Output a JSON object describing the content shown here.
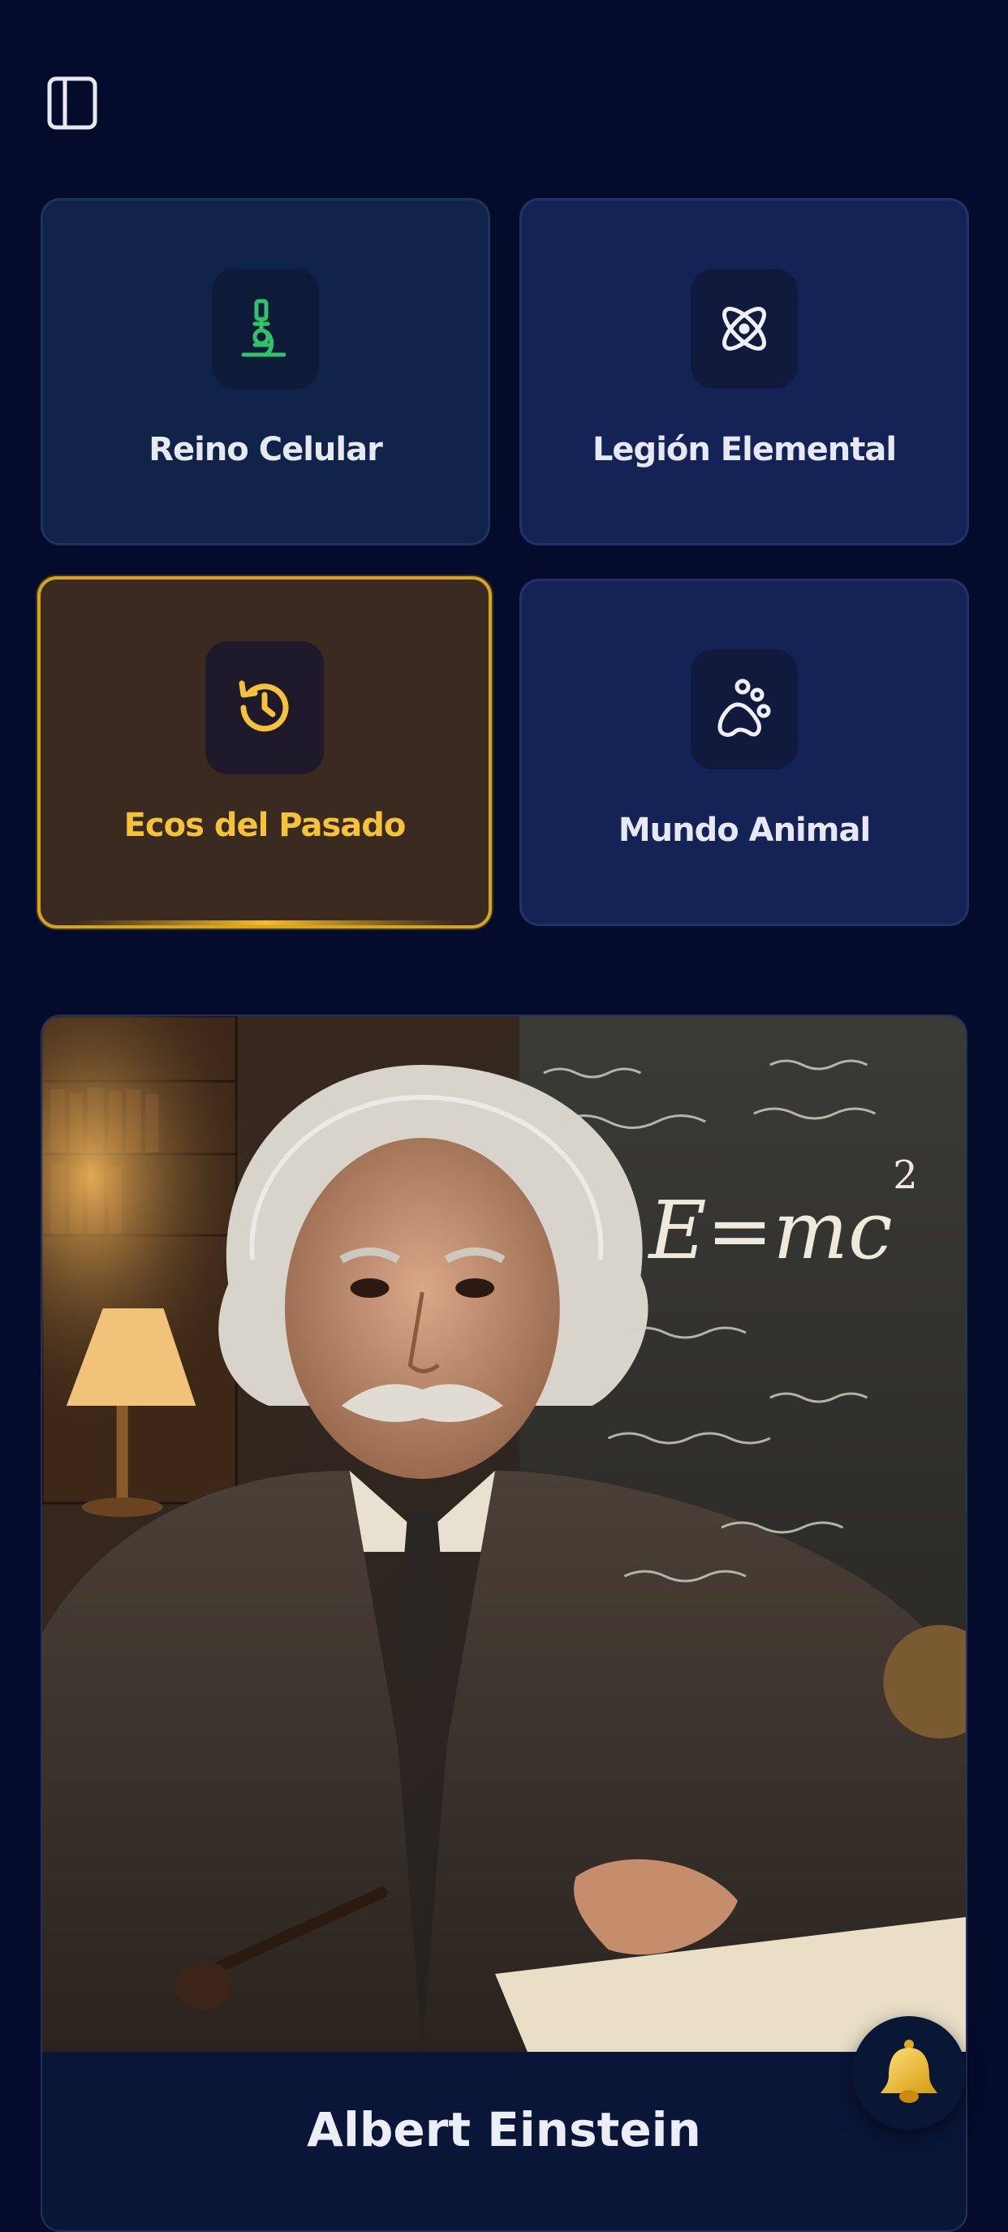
{
  "sidebar_toggle": {
    "icon": "sidebar-panel-icon"
  },
  "categories": [
    {
      "label": "Reino Celular",
      "icon": "microscope-icon",
      "color": "#2fc36a",
      "selected": false
    },
    {
      "label": "Legión Elemental",
      "icon": "atom-icon",
      "color": "#eef0f8",
      "selected": false
    },
    {
      "label": "Ecos del Pasado",
      "icon": "history-clock-icon",
      "color": "#f5c23a",
      "selected": true
    },
    {
      "label": "Mundo Animal",
      "icon": "paw-icon",
      "color": "#eef0f8",
      "selected": false
    }
  ],
  "featured": {
    "name": "Albert Einstein",
    "image": "albert-einstein-portrait",
    "chalkboard_text": [
      "E=mc",
      "2"
    ]
  },
  "notification_button": {
    "icon": "bell-icon"
  },
  "colors": {
    "background": "#040b2b",
    "accent_gold": "#f5c23a",
    "accent_green": "#2fc36a"
  }
}
